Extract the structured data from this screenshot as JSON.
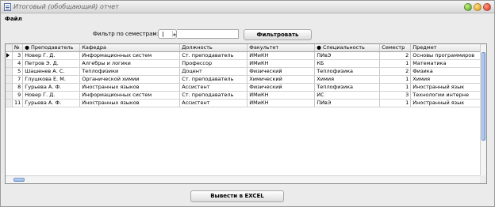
{
  "window": {
    "title": "Итоговый (обобщающий) отчет"
  },
  "menu": {
    "file": "Файл"
  },
  "filter": {
    "label": "Фильтр по семестрам:",
    "value": "",
    "button": "Фильтровать"
  },
  "table": {
    "columns": [
      "№",
      "● Преподаватель",
      "Кафедра",
      "Должность",
      "Факультет",
      "● Специальность",
      "Семестр",
      "Предмет"
    ],
    "rows": [
      {
        "num": "3",
        "teacher": "Новер Г. Д.",
        "dept": "Информационных систем",
        "position": "Ст. преподаватель",
        "faculty": "ИМиКН",
        "specialty": "ПИвЭ",
        "semester": "2",
        "subject": "Основы программиров"
      },
      {
        "num": "4",
        "teacher": "Петров Э. Д.",
        "dept": "Алгебры и логики",
        "position": "Профессор",
        "faculty": "ИМиКН",
        "specialty": "КБ",
        "semester": "1",
        "subject": "Математика"
      },
      {
        "num": "5",
        "teacher": "Шашенев А. С.",
        "dept": "Теплофизики",
        "position": "Доцент",
        "faculty": "Физический",
        "specialty": "Теплофизика",
        "semester": "2",
        "subject": "Физика"
      },
      {
        "num": "7",
        "teacher": "Глушкова Е. М.",
        "dept": "Органической химии",
        "position": "Ст. преподаватель",
        "faculty": "Химический",
        "specialty": "Химия",
        "semester": "1",
        "subject": "Химия"
      },
      {
        "num": "8",
        "teacher": "Гурьева А. Ф.",
        "dept": "Иностранных языков",
        "position": "Ассистент",
        "faculty": "Физический",
        "specialty": "Теплофизика",
        "semester": "1",
        "subject": "Иностранный язык"
      },
      {
        "num": "9",
        "teacher": "Новер Г. Д.",
        "dept": "Информационных систем",
        "position": "Ст. преподаватель",
        "faculty": "ИМиКН",
        "specialty": "ИС",
        "semester": "3",
        "subject": "Технологии интерне"
      },
      {
        "num": "11",
        "teacher": "Гурьева А. Ф.",
        "dept": "Иностранных языков",
        "position": "Ассистент",
        "faculty": "ИМиКН",
        "specialty": "ПИвЭ",
        "semester": "1",
        "subject": "Иностранный язык"
      }
    ]
  },
  "export": {
    "button": "Вывести в EXCEL"
  },
  "colors": {
    "scroll_thumb": "#8fb1e4",
    "close": "#d2301a",
    "maximize": "#d9950f",
    "minimize": "#4e9b1c"
  }
}
